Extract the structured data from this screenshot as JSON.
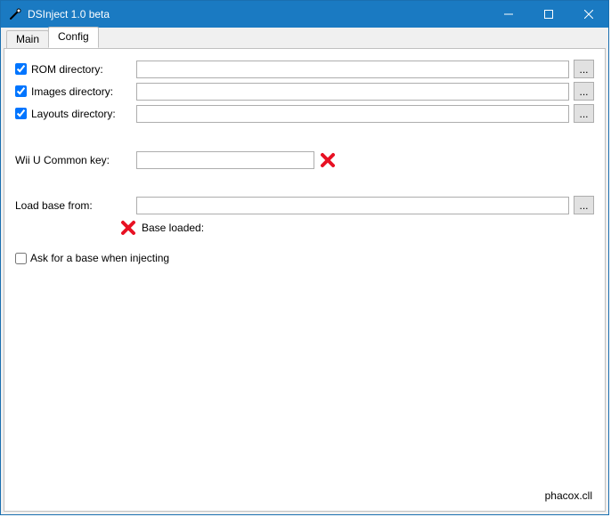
{
  "window": {
    "title": "DSInject 1.0 beta"
  },
  "tabs": {
    "main": "Main",
    "config": "Config"
  },
  "config": {
    "rom": {
      "checked": true,
      "label": "ROM directory:",
      "value": "",
      "browse": "..."
    },
    "images": {
      "checked": true,
      "label": "Images directory:",
      "value": "",
      "browse": "..."
    },
    "layouts": {
      "checked": true,
      "label": "Layouts directory:",
      "value": "",
      "browse": "..."
    },
    "commonKey": {
      "label": "Wii U Common key:",
      "value": ""
    },
    "loadBase": {
      "label": "Load base from:",
      "value": "",
      "browse": "..."
    },
    "baseStatus": "Base loaded:",
    "askWhenInject": {
      "checked": false,
      "label": "Ask for a base when injecting"
    }
  },
  "footer": "phacox.cll"
}
